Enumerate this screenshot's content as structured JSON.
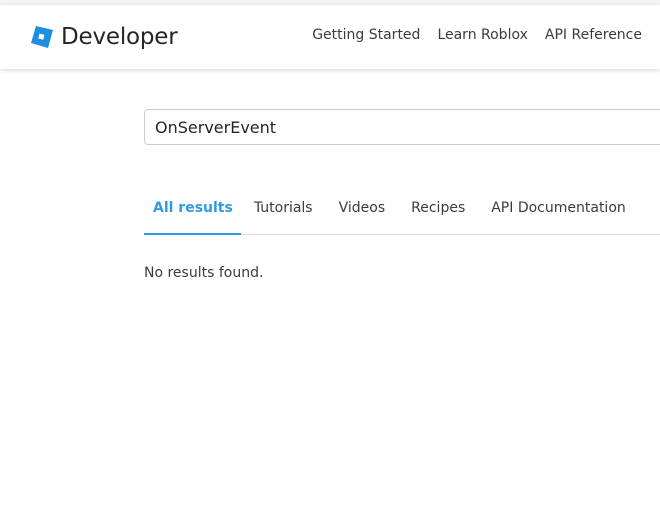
{
  "header": {
    "brand": "Developer",
    "nav": [
      "Getting Started",
      "Learn Roblox",
      "API Reference"
    ]
  },
  "search": {
    "value": "OnServerEvent"
  },
  "tabs": [
    {
      "label": "All results",
      "active": true
    },
    {
      "label": "Tutorials",
      "active": false
    },
    {
      "label": "Videos",
      "active": false
    },
    {
      "label": "Recipes",
      "active": false
    },
    {
      "label": "API Documentation",
      "active": false
    }
  ],
  "results": {
    "message": "No results found."
  },
  "colors": {
    "accent": "#2f9be5",
    "logo": "#1e8fe0"
  }
}
